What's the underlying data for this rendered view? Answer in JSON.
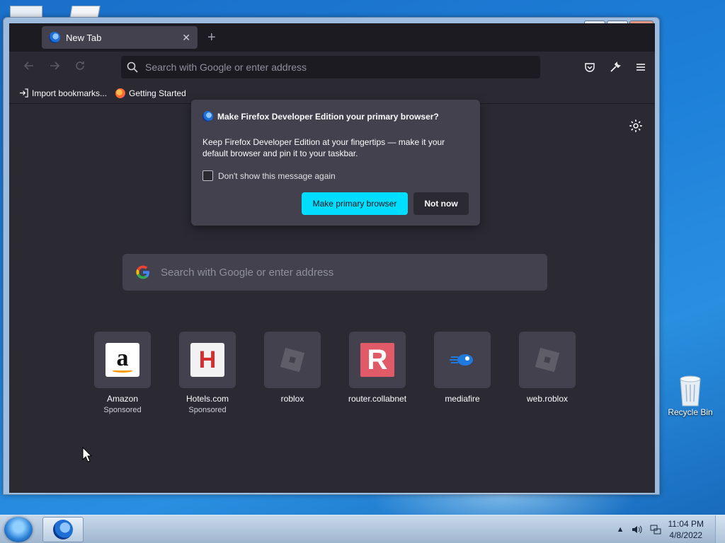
{
  "browser": {
    "tab_title": "New Tab",
    "new_tab_symbol": "+",
    "tab_close_symbol": "✕",
    "url_placeholder": "Search with Google or enter address",
    "bookmarks": [
      {
        "label": "Import bookmarks..."
      },
      {
        "label": "Getting Started"
      }
    ]
  },
  "window_controls": {
    "minimize": "—",
    "maximize": "▢",
    "close": "✕"
  },
  "popup": {
    "title": "Make Firefox Developer Edition your primary browser?",
    "body": "Keep Firefox Developer Edition at your fingertips — make it your default browser and pin it to your taskbar.",
    "checkbox_label": "Don't show this message again",
    "primary_button": "Make primary browser",
    "secondary_button": "Not now"
  },
  "newtab": {
    "search_placeholder": "Search with Google or enter address",
    "top_sites": [
      {
        "name": "Amazon",
        "sponsored": "Sponsored",
        "icon": "amazon-icon"
      },
      {
        "name": "Hotels.com",
        "sponsored": "Sponsored",
        "icon": "hotels-icon"
      },
      {
        "name": "roblox",
        "sponsored": "",
        "icon": "roblox-icon"
      },
      {
        "name": "router.collabnet",
        "sponsored": "",
        "icon": "r-icon"
      },
      {
        "name": "mediafire",
        "sponsored": "",
        "icon": "mediafire-icon"
      },
      {
        "name": "web.roblox",
        "sponsored": "",
        "icon": "roblox-icon"
      }
    ]
  },
  "desktop": {
    "recycle_bin": "Recycle Bin"
  },
  "taskbar": {
    "time": "11:04 PM",
    "date": "4/8/2022"
  },
  "colors": {
    "accent": "#00ddff",
    "panel": "#42414d",
    "background": "#2b2a33"
  }
}
